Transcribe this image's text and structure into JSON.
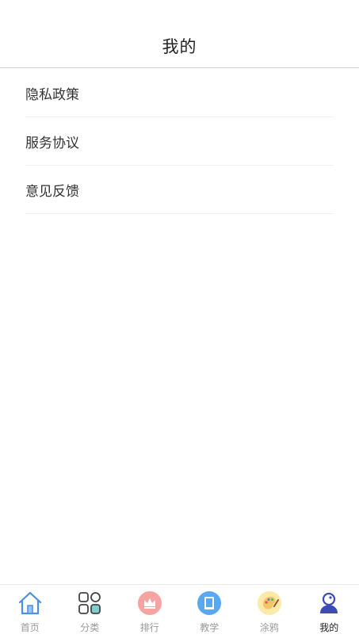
{
  "header": {
    "title": "我的"
  },
  "menu": {
    "items": [
      {
        "label": "隐私政策"
      },
      {
        "label": "服务协议"
      },
      {
        "label": "意见反馈"
      }
    ]
  },
  "tabbar": {
    "active_index": 5,
    "tabs": [
      {
        "label": "首页",
        "icon": "home-icon"
      },
      {
        "label": "分类",
        "icon": "category-icon"
      },
      {
        "label": "排行",
        "icon": "crown-icon"
      },
      {
        "label": "教学",
        "icon": "book-icon"
      },
      {
        "label": "涂鸦",
        "icon": "palette-icon"
      },
      {
        "label": "我的",
        "icon": "user-icon"
      }
    ]
  },
  "colors": {
    "active_tab": "#3f4bb5",
    "home_icon": "#4a90e2",
    "crown_icon_bg": "#f5a3a3",
    "book_icon_bg": "#5aa8f0",
    "palette_icon_bg": "#fde9a8"
  }
}
